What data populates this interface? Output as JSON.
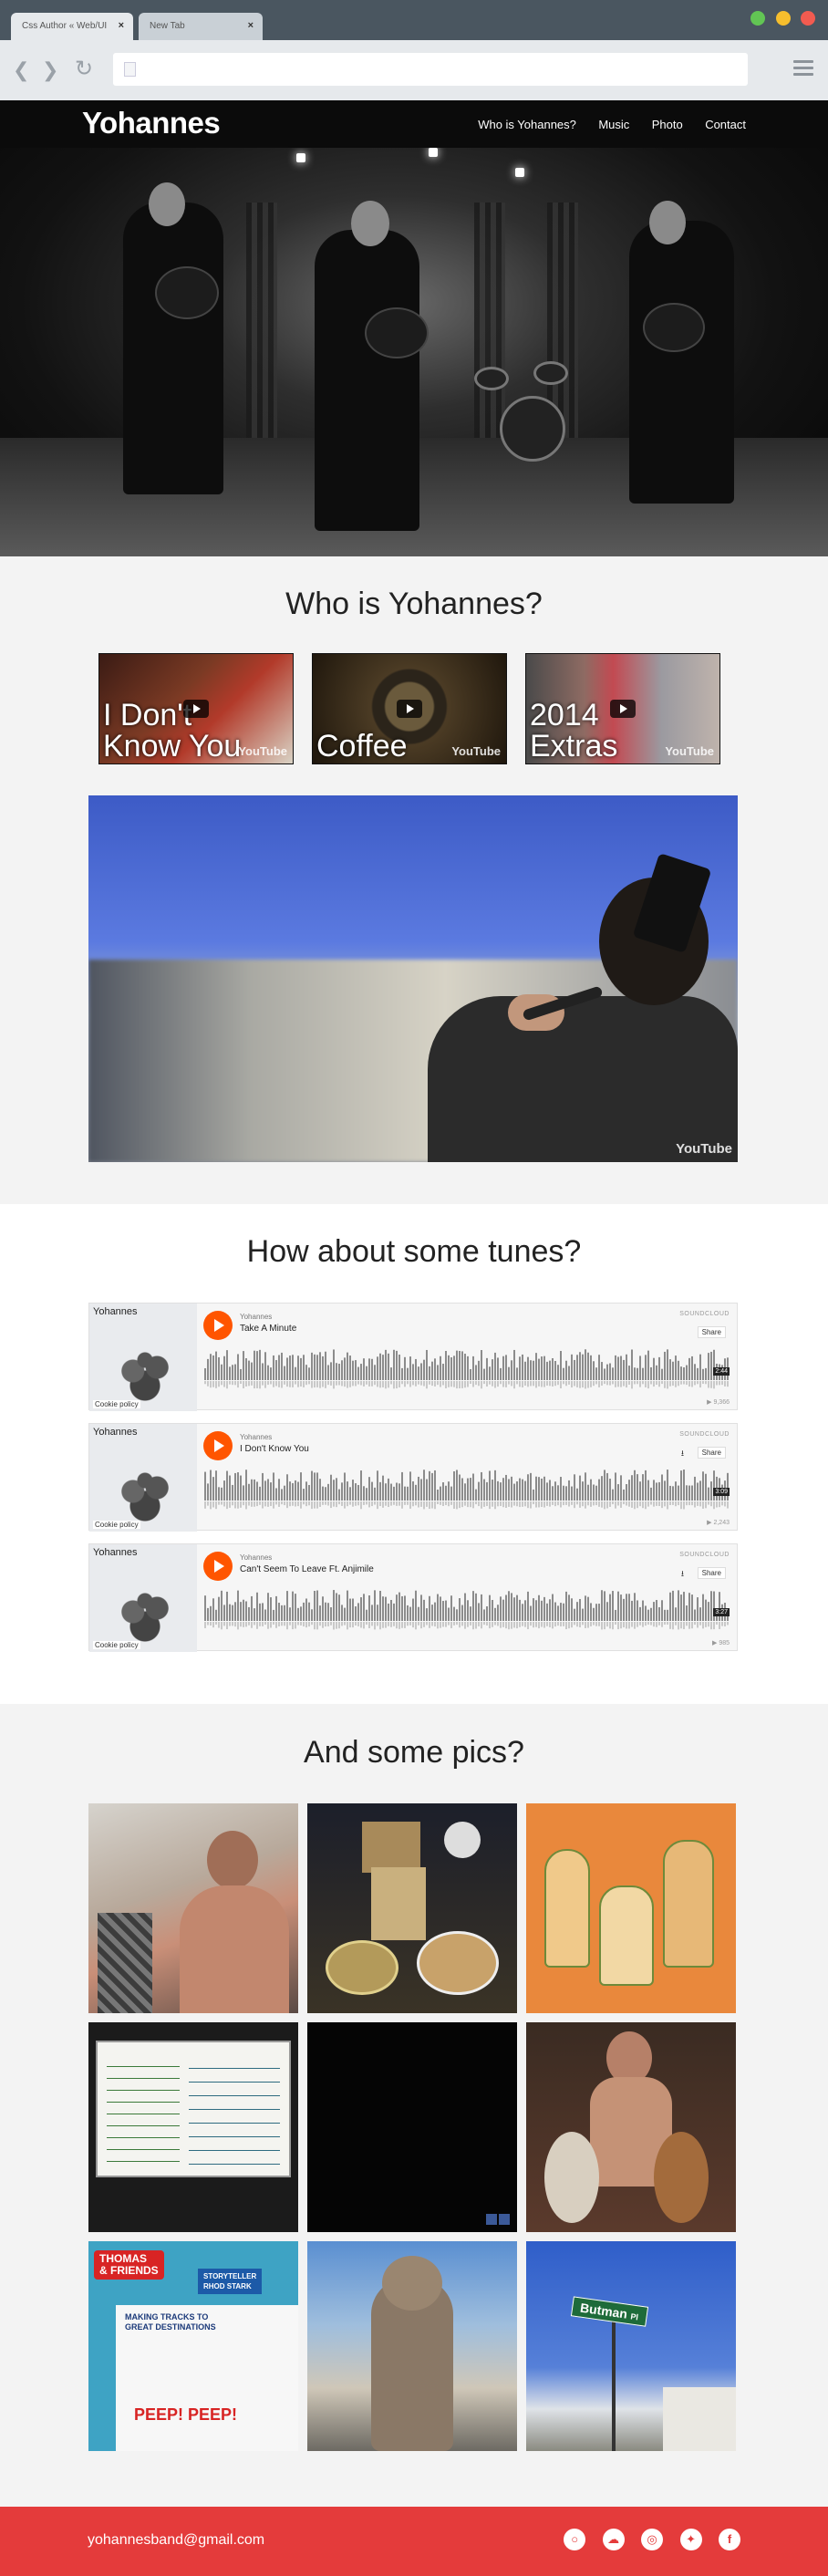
{
  "browser": {
    "tabs": [
      {
        "label": "Css Author « Web/UI",
        "active": true
      },
      {
        "label": "New Tab",
        "active": false
      }
    ],
    "traffic_lights": [
      "#62c554",
      "#f6be2d",
      "#f25b50"
    ],
    "address_value": ""
  },
  "site": {
    "logo": "Yohannes",
    "nav": [
      "Who is Yohannes?",
      "Music",
      "Photo",
      "Contact"
    ]
  },
  "who": {
    "title": "Who is Yohannes?",
    "videos": [
      {
        "caption_line1": "I Don't",
        "caption_line2": "Know You",
        "brand": "YouTube"
      },
      {
        "caption_line1": "",
        "caption_line2": "Coffee",
        "brand": "YouTube"
      },
      {
        "caption_line1": "2014",
        "caption_line2": "Extras",
        "brand": "YouTube"
      }
    ],
    "featured_brand": "YouTube"
  },
  "tunes": {
    "title": "How about some tunes?",
    "players": [
      {
        "band": "Yohannes",
        "artist": "Yohannes",
        "track": "Take A Minute",
        "time": "2:44",
        "plays": "▶ 9,366",
        "cookie": "Cookie policy",
        "share": "Share",
        "brand": "SOUNDCLOUD",
        "download": false
      },
      {
        "band": "Yohannes",
        "artist": "Yohannes",
        "track": "I Don't Know You",
        "time": "3:09",
        "plays": "▶ 2,243",
        "cookie": "Cookie policy",
        "share": "Share",
        "brand": "SOUNDCLOUD",
        "download": true
      },
      {
        "band": "Yohannes",
        "artist": "Yohannes",
        "track": "Can't Seem To Leave Ft. Anjimile",
        "time": "3:27",
        "plays": "▶ 985",
        "cookie": "Cookie policy",
        "share": "Share",
        "brand": "SOUNDCLOUD",
        "download": true
      }
    ]
  },
  "pics": {
    "title": "And some pics?",
    "poster_text": [
      "THOMAS",
      "& FRIENDS",
      "STORYTELLER",
      "RHOD STARK",
      "MAKING TRACKS TO",
      "GREAT DESTINATIONS",
      "PEEP! PEEP!"
    ],
    "sign_text": "Butman",
    "sign_suffix": "Pl"
  },
  "footer": {
    "email": "yohannesband@gmail.com",
    "social_icons": [
      "soundcloud-icon",
      "cloud-icon",
      "instagram-icon",
      "twitter-icon",
      "facebook-icon"
    ]
  }
}
